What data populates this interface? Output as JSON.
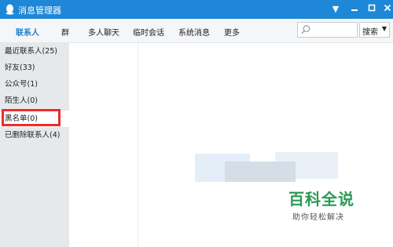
{
  "window": {
    "title": "消息管理器"
  },
  "nav": {
    "tabs": [
      {
        "label": "联系人",
        "active": true
      },
      {
        "label": "群"
      },
      {
        "label": "多人聊天"
      },
      {
        "label": "临时会话"
      },
      {
        "label": "系统消息"
      },
      {
        "label": "更多"
      }
    ]
  },
  "search": {
    "placeholder": "",
    "button_label": "搜索"
  },
  "sidebar": {
    "items": [
      {
        "label": "最近联系人(25)"
      },
      {
        "label": "好友(33)"
      },
      {
        "label": "公众号(1)"
      },
      {
        "label": "陌生人(0)"
      },
      {
        "label": "黑名单(0)",
        "selected": true
      },
      {
        "label": "已删除联系人(4)"
      }
    ]
  },
  "watermark": {
    "title": "百科全说",
    "subtitle": "助你轻松解决"
  },
  "colors": {
    "titlebar": "#1e87d8",
    "accent": "#1e7fd0",
    "highlight": "#ee2b2b",
    "watermark": "#2a9a55"
  }
}
